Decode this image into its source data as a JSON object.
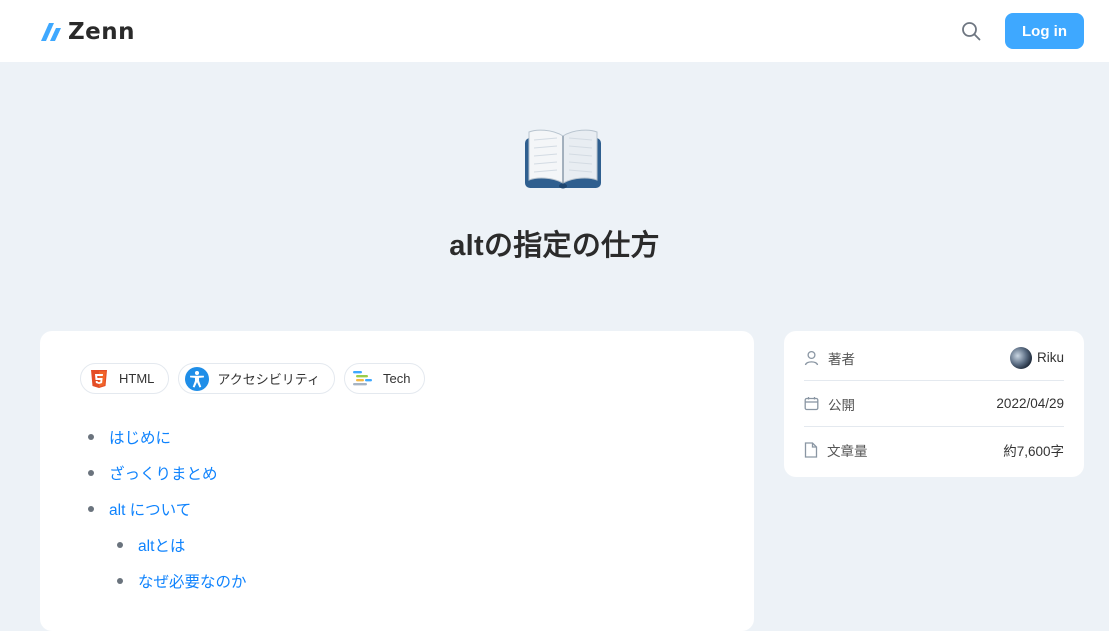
{
  "header": {
    "logo_text": "Zenn",
    "search_icon": "search-icon",
    "login_label": "Log in"
  },
  "article": {
    "emoji": "open-book-emoji",
    "title": "altの指定の仕方",
    "topics": [
      {
        "label": "HTML",
        "icon": "html5-icon"
      },
      {
        "label": "アクセシビリティ",
        "icon": "accessibility-icon"
      },
      {
        "label": "Tech",
        "icon": "tech-icon"
      }
    ],
    "toc": [
      {
        "label": "はじめに",
        "level": 1
      },
      {
        "label": "ざっくりまとめ",
        "level": 1
      },
      {
        "label": "alt について",
        "level": 1
      },
      {
        "label": "altとは",
        "level": 2
      },
      {
        "label": "なぜ必要なのか",
        "level": 2
      }
    ]
  },
  "sidebar": {
    "author_label": "著者",
    "author_name": "Riku",
    "published_label": "公開",
    "published_value": "2022/04/29",
    "length_label": "文章量",
    "length_value": "約7,600字"
  },
  "colors": {
    "accent": "#3ea8ff",
    "link": "#0f83fd",
    "background": "#edf2f7"
  }
}
